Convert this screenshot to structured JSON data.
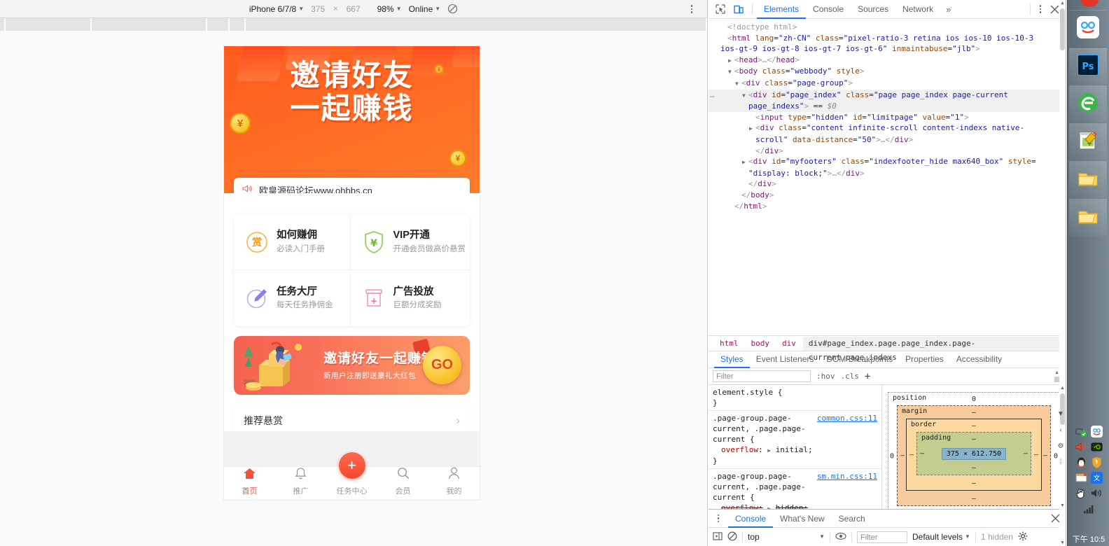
{
  "device_toolbar": {
    "device": "iPhone 6/7/8",
    "width": "375",
    "times": "×",
    "height": "667",
    "zoom": "98%",
    "network": "Online",
    "throttle_icon": "no-throttling-icon",
    "menu_icon": "kebab-menu-icon"
  },
  "devtools": {
    "toolbar": {
      "inspect_icon": "inspect-element-icon",
      "device_toggle_icon": "device-toolbar-icon",
      "tabs": [
        "Elements",
        "Console",
        "Sources",
        "Network"
      ],
      "selected_tab": "Elements",
      "more_tabs": "»",
      "settings_icon": "kebab-menu-icon",
      "close_icon": "close-icon"
    },
    "dom_lines": [
      {
        "indent": 1,
        "html": "<span class='cm'>&lt;!doctype html&gt;</span>"
      },
      {
        "indent": 1,
        "html": "<span class='pn'>&lt;</span><span class='tg'>html</span> <span class='at'>lang</span>=<span class='av'>\"zh-CN\"</span> <span class='at'>class</span>=<span class='av'>\"pixel-ratio-3 retina ios ios-10 ios-10-3</span>"
      },
      {
        "indent": 0,
        "html": "<span class='av'>ios-gt-9 ios-gt-8 ios-gt-7 ios-gt-6\"</span> <span class='at'>inmaintabuse</span>=<span class='av'>\"jlb\"</span><span class='pn'>&gt;</span>"
      },
      {
        "indent": 2,
        "tri": "▶",
        "html": "<span class='pn'>&lt;</span><span class='tg'>head</span><span class='pn'>&gt;</span><span class='cm'>…</span><span class='pn'>&lt;/</span><span class='tg'>head</span><span class='pn'>&gt;</span>"
      },
      {
        "indent": 2,
        "tri": "▼",
        "html": "<span class='pn'>&lt;</span><span class='tg'>body</span> <span class='at'>class</span>=<span class='av'>\"webbody\"</span> <span class='at'>style</span><span class='pn'>&gt;</span>"
      },
      {
        "indent": 3,
        "tri": "▼",
        "html": "<span class='pn'>&lt;</span><span class='tg'>div</span> <span class='at'>class</span>=<span class='av'>\"page-group\"</span><span class='pn'>&gt;</span>"
      },
      {
        "indent": 4,
        "tri": "▼",
        "sel": true,
        "badge": "…",
        "html": "<span class='pn'>&lt;</span><span class='tg'>div</span> <span class='at'>id</span>=<span class='av'>\"page_index\"</span> <span class='at'>class</span>=<span class='av'>\"page page_index page-current</span>"
      },
      {
        "indent": 4,
        "sel": true,
        "html": "<span class='av'>page_indexs\"</span><span class='pn'>&gt;</span> == <span class='dollar'>$0</span>"
      },
      {
        "indent": 5,
        "html": "<span class='pn'>&lt;</span><span class='tg'>input</span> <span class='at'>type</span>=<span class='av'>\"hidden\"</span> <span class='at'>id</span>=<span class='av'>\"limitpage\"</span> <span class='at'>value</span>=<span class='av'>\"1\"</span><span class='pn'>&gt;</span>"
      },
      {
        "indent": 5,
        "tri": "▶",
        "html": "<span class='pn'>&lt;</span><span class='tg'>div</span> <span class='at'>class</span>=<span class='av'>\"content infinite-scroll content-indexs native-</span>"
      },
      {
        "indent": 5,
        "html": "<span class='av'>scroll\"</span> <span class='at'>data-distance</span>=<span class='av'>\"50\"</span><span class='pn'>&gt;</span><span class='cm'>…</span><span class='pn'>&lt;/</span><span class='tg'>div</span><span class='pn'>&gt;</span>"
      },
      {
        "indent": 5,
        "html": "<span class='pn'>&lt;/</span><span class='tg'>div</span><span class='pn'>&gt;</span>"
      },
      {
        "indent": 4,
        "tri": "▶",
        "html": "<span class='pn'>&lt;</span><span class='tg'>div</span> <span class='at'>id</span>=<span class='av'>\"myfooters\"</span> <span class='at'>class</span>=<span class='av'>\"indexfooter_hide max640_box\"</span> <span class='at'>style</span>="
      },
      {
        "indent": 4,
        "html": "<span class='av'>\"display: block;\"</span><span class='pn'>&gt;</span><span class='cm'>…</span><span class='pn'>&lt;/</span><span class='tg'>div</span><span class='pn'>&gt;</span>"
      },
      {
        "indent": 4,
        "html": "<span class='pn'>&lt;/</span><span class='tg'>div</span><span class='pn'>&gt;</span>"
      },
      {
        "indent": 3,
        "html": "<span class='pn'>&lt;/</span><span class='tg'>body</span><span class='pn'>&gt;</span>"
      },
      {
        "indent": 2,
        "html": "<span class='pn'>&lt;/</span><span class='tg'>html</span><span class='pn'>&gt;</span>"
      }
    ],
    "breadcrumb": [
      "html",
      "body",
      "div",
      "div#page_index.page.page_index.page-current.page_indexs"
    ],
    "breadcrumb_current": "div#page_index.page.page_index.page-current.page_indexs",
    "style_tabs": [
      "Styles",
      "Event Listeners",
      "DOM Breakpoints",
      "Properties",
      "Accessibility"
    ],
    "style_tab_selected": "Styles",
    "filter": {
      "placeholder": "Filter",
      "hov": ":hov",
      "cls": ".cls",
      "plus": "+"
    },
    "rules": [
      {
        "selector": "element.style {",
        "source": "",
        "prop": "",
        "value": "",
        "close": "}"
      },
      {
        "selector": ".page-group.page-current, .page.page-current {",
        "source": "common.css:11",
        "prop": "overflow",
        "value": "initial;",
        "close": "}",
        "struck": false
      },
      {
        "selector": ".page-group.page-current, .page.page-current {",
        "source": "sm.min.css:11",
        "prop": "overflow",
        "value": "hidden;",
        "close": "",
        "struck": true
      }
    ],
    "box_model": {
      "position": "position",
      "position_value": "0",
      "margin": "margin",
      "margin_value": "–",
      "border": "border",
      "border_value": "–",
      "padding": "padding",
      "padding_value": "–",
      "content": "375 × 612.750",
      "left_outer": "0",
      "right_outer": "0",
      "dash": "–"
    },
    "drawer": {
      "kebab_icon": "kebab-menu-icon",
      "tabs": [
        "Console",
        "What's New",
        "Search"
      ],
      "selected_tab": "Console",
      "close_icon": "close-icon",
      "execute_icon": "execution-context-icon",
      "clear_icon": "clear-console-icon",
      "context": "top",
      "eye_icon": "live-expression-icon",
      "filter_placeholder": "Filter",
      "levels": "Default levels",
      "hidden_count": "1 hidden",
      "settings_icon": "gear-icon"
    }
  },
  "phone": {
    "hero": {
      "line1": "邀请好友",
      "line2": "一起赚钱",
      "coin_glyph": "¥"
    },
    "notice": {
      "icon": "speaker-icon",
      "text": "欧皇源码论坛www.ohbbs.cn"
    },
    "grid": [
      {
        "icon": "reward-circle-icon",
        "glyph": "赏",
        "color": "#f5a623",
        "title": "如何赚佣",
        "subtitle": "必读入门手册"
      },
      {
        "icon": "vip-shield-icon",
        "glyph": "¥",
        "color": "#8bc34a",
        "title": "VIP开通",
        "subtitle": "开通会员做高价悬赏"
      },
      {
        "icon": "pen-circle-icon",
        "glyph": "",
        "color": "#8b80e8",
        "title": "任务大厅",
        "subtitle": "每天任务挣佣金"
      },
      {
        "icon": "gift-box-icon",
        "glyph": "+",
        "color": "#f48fb1",
        "title": "广告投放",
        "subtitle": "巨额分成奖励"
      }
    ],
    "promo": {
      "title": "邀请好友一起赚钱",
      "subtitle": "新用户注册即送豪礼大红包",
      "cta": "GO",
      "cta_arrow": "›"
    },
    "list_row": {
      "label": "推荐悬赏",
      "chevron": "›"
    },
    "tabbar": [
      {
        "icon": "home-icon",
        "label": "首页",
        "active": true
      },
      {
        "icon": "bell-icon",
        "label": "推广",
        "active": false
      },
      {
        "icon": "plus-fab-icon",
        "label": "任务中心",
        "active": false
      },
      {
        "icon": "search-icon",
        "label": "会员",
        "active": false
      },
      {
        "icon": "user-icon",
        "label": "我的",
        "active": false
      }
    ],
    "fab": {
      "icon": "plus-icon",
      "glyph": "+"
    }
  },
  "taskbar": {
    "buttons": [
      {
        "icon": "baidu-netdisk-icon"
      },
      {
        "icon": "photoshop-icon"
      },
      {
        "icon": "browser-e-icon"
      },
      {
        "icon": "notepad-plus-plus-icon"
      },
      {
        "icon": "folder-icon"
      },
      {
        "icon": "folder-icon-2"
      }
    ],
    "tray": [
      {
        "icon": "usb-device-ok-icon"
      },
      {
        "icon": "baidu-netdisk-tray-icon"
      },
      {
        "icon": "volume-mute-icon"
      },
      {
        "icon": "nvidia-icon"
      },
      {
        "icon": "qq-penguin-icon"
      },
      {
        "icon": "security-shield-icon"
      },
      {
        "icon": "window-app-icon"
      },
      {
        "icon": "translate-icon"
      },
      {
        "icon": "hand-tool-icon"
      },
      {
        "icon": "volume-icon"
      },
      {
        "icon": "signal-bars-icon"
      }
    ],
    "clock": "下午 10:5"
  },
  "colors": {
    "accent_blue": "#1a73e8",
    "brand_orange": "#ff6a22",
    "brand_red": "#f5513b",
    "content_box": "#87b3cc",
    "padding_box": "#c2cd8f",
    "border_box": "#fdd9a0",
    "margin_box": "#f8cb9c"
  }
}
